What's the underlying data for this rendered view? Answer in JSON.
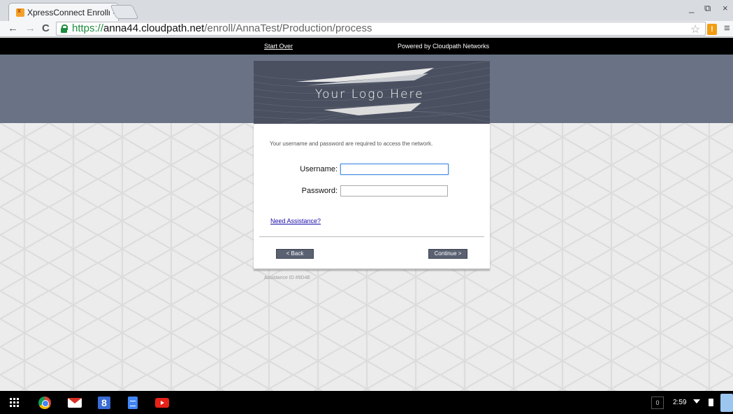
{
  "browser": {
    "tab_title": "XpressConnect Enrollme",
    "tab_close": "×",
    "url_scheme": "https://",
    "url_host": "anna44.cloudpath.net",
    "url_path": "/enroll/AnnaTest/Production/process",
    "back_icon": "←",
    "forward_icon": "→",
    "reload_icon": "C",
    "star_icon": "☆",
    "extension_label": "!",
    "menu_icon": "≡",
    "minimize": "_",
    "restore": "⧉",
    "close": "×"
  },
  "page": {
    "start_over": "Start Over",
    "powered_by": "Powered by Cloudpath Networks",
    "logo_text": "Your Logo Here",
    "intro": "Your username and password are required to access the network.",
    "username_label": "Username:",
    "username_value": "",
    "password_label": "Password:",
    "password_value": "",
    "need_assistance": "Need Assistance?",
    "back_button": "< Back",
    "continue_button": "Continue >",
    "assistance_id": "Assistance ID #9D4E"
  },
  "taskbar": {
    "notification_count": "0",
    "clock": "2:59",
    "gplus_label": "8"
  },
  "colors": {
    "header_band": "#6a7385",
    "button": "#5a6272",
    "link": "#1a0dab",
    "secure_green": "#1e8e3e"
  }
}
